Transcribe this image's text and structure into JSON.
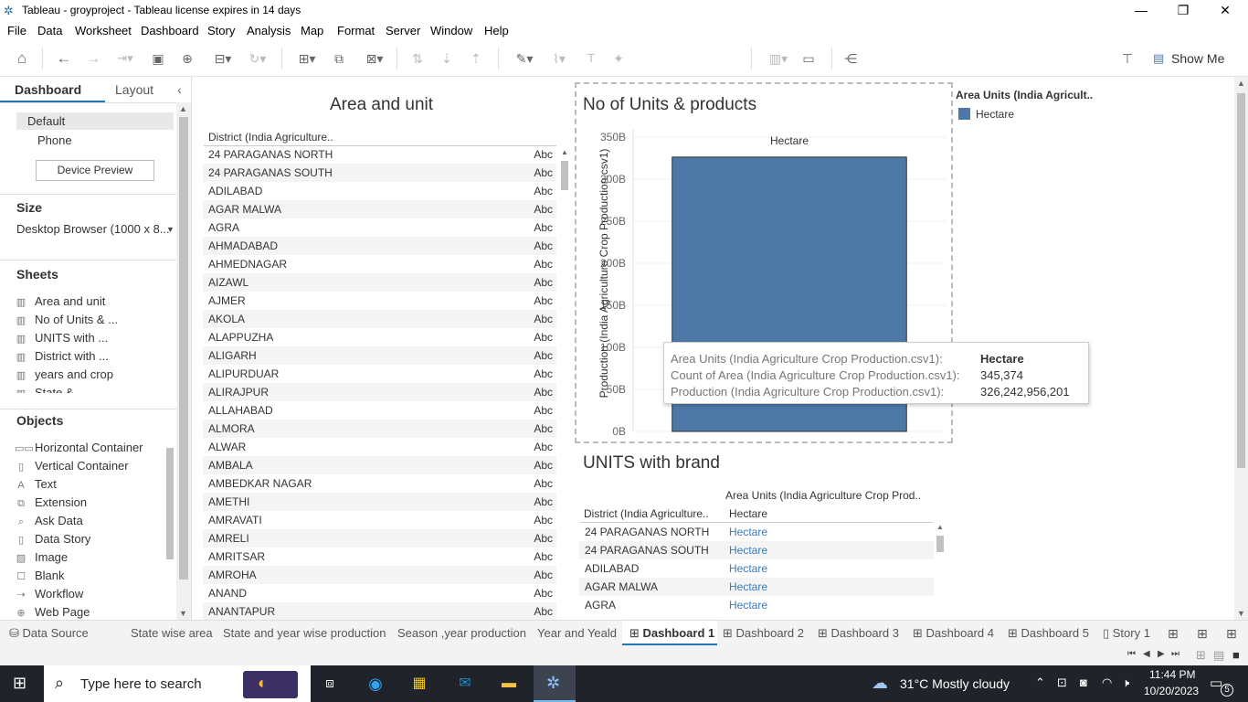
{
  "window": {
    "title": "Tableau - groyproject - Tableau license expires in 14 days"
  },
  "menu": [
    "File",
    "Data",
    "Worksheet",
    "Dashboard",
    "Story",
    "Analysis",
    "Map",
    "Format",
    "Server",
    "Window",
    "Help"
  ],
  "toolbar": {
    "show_me": "Show Me"
  },
  "left_panel": {
    "tabs": [
      "Dashboard",
      "Layout"
    ],
    "devices": [
      "Default",
      "Phone"
    ],
    "device_preview": "Device Preview",
    "size_heading": "Size",
    "size_value": "Desktop Browser (1000 x 8...",
    "sheets_heading": "Sheets",
    "sheets": [
      "Area and unit",
      "No of Units & ...",
      "UNITS with ...",
      "District with ...",
      "years and crop",
      "State &"
    ],
    "objects_heading": "Objects",
    "objects": [
      "Horizontal Container",
      "Vertical Container",
      "Text",
      "Extension",
      "Ask Data",
      "Data Story",
      "Image",
      "Blank",
      "Workflow",
      "Web Page"
    ]
  },
  "area_and_unit": {
    "title": "Area and unit",
    "header": "District (India Agriculture..",
    "cell_value": "Abc",
    "districts": [
      "24 PARAGANAS NORTH",
      "24 PARAGANAS SOUTH",
      "ADILABAD",
      "AGAR MALWA",
      "AGRA",
      "AHMADABAD",
      "AHMEDNAGAR",
      "AIZAWL",
      "AJMER",
      "AKOLA",
      "ALAPPUZHA",
      "ALIGARH",
      "ALIPURDUAR",
      "ALIRAJPUR",
      "ALLAHABAD",
      "ALMORA",
      "ALWAR",
      "AMBALA",
      "AMBEDKAR NAGAR",
      "AMETHI",
      "AMRAVATI",
      "AMRELI",
      "AMRITSAR",
      "AMROHA",
      "ANAND",
      "ANANTAPUR"
    ]
  },
  "units_products": {
    "title": "No of Units & products",
    "legend_title": "Area Units (India Agricult..",
    "legend_item": "Hectare",
    "color": "#4e79a7",
    "chart_data": {
      "type": "bar",
      "categories": [
        "Hectare"
      ],
      "values": [
        326242956201
      ],
      "ylabel": "Production (India Agriculture Crop Production.csv1)",
      "ylim": [
        0,
        350000000000
      ],
      "yticks": [
        "0B",
        "50B",
        "100B",
        "150B",
        "200B",
        "250B",
        "300B",
        "350B"
      ]
    },
    "tooltip": [
      {
        "k": "Area Units (India Agriculture Crop Production.csv1):",
        "v": "Hectare"
      },
      {
        "k": "Count of Area (India Agriculture Crop Production.csv1):",
        "v": "345,374"
      },
      {
        "k": "Production (India Agriculture Crop Production.csv1):",
        "v": "326,242,956,201"
      }
    ]
  },
  "units_brand": {
    "title": "UNITS with brand",
    "col_header": "Area Units (India Agriculture Crop Prod..",
    "row_header": "District (India Agriculture..",
    "col_value": "Hectare",
    "rows": [
      "24 PARAGANAS NORTH",
      "24 PARAGANAS SOUTH",
      "ADILABAD",
      "AGAR MALWA",
      "AGRA"
    ],
    "link_color": "#3d7ab8"
  },
  "bottom_tabs": [
    "Data Source",
    "State wise area",
    "State and year wise production",
    "Season ,year production",
    "Year and Yeald",
    "Dashboard 1",
    "Dashboard 2",
    "Dashboard 3",
    "Dashboard 4",
    "Dashboard 5",
    "Story 1"
  ],
  "taskbar": {
    "search_placeholder": "Type here to search",
    "weather": "31°C  Mostly cloudy",
    "time": "11:44 PM",
    "date": "10/20/2023",
    "notifications": "5"
  }
}
